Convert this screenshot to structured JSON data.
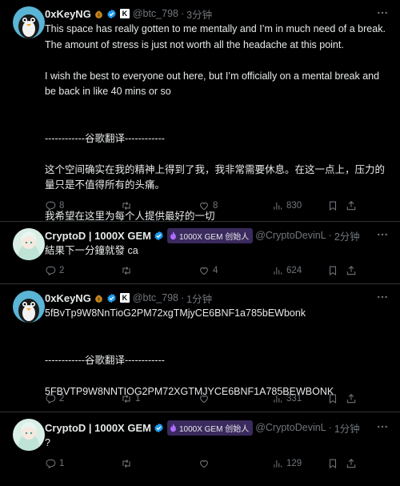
{
  "posts": [
    {
      "name": "0xKeyNG",
      "handle": "@btc_798",
      "time": "3分钟",
      "text": "This space has really gotten to me mentally and I’m in much need of a break. The amount of stress is just not worth all the headache at this point.\n\nI wish the best to everyone out here, but I’m officially on a mental break and be back in like 40 mins or so\n\n\n------------谷歌翻译------------\n\n这个空间确实在我的精神上得到了我，我非常需要休息。在这一点上，压力的量只是不值得所有的头痛。\n\n我希望在这里为每个人提供最好的一切",
      "replies": "8",
      "reposts": "",
      "likes": "8",
      "views": "830"
    },
    {
      "name": "CryptoD | 1000X GEM",
      "badge": "1000X GEM 创始人",
      "handle": "@CryptoDevinL",
      "time": "2分钟",
      "text": "結果下一分鐘就發 ca",
      "replies": "2",
      "reposts": "",
      "likes": "4",
      "views": "624"
    },
    {
      "name": "0xKeyNG",
      "handle": "@btc_798",
      "time": "1分钟",
      "text": "5fBvTp9W8NnTioG2PM72xgTMjyCE6BNF1a785bEWbonk\n\n\n------------谷歌翻译------------\n\n5FBVTP9W8NNTIOG2PM72XGTMJYCE6BNF1A785BEWBONK",
      "replies": "2",
      "reposts": "1",
      "likes": "",
      "views": "331"
    },
    {
      "name": "CryptoD | 1000X GEM",
      "badge": "1000X GEM 创始人",
      "handle": "@CryptoDevinL",
      "time": "1分钟",
      "text": "?",
      "replies": "1",
      "reposts": "",
      "likes": "",
      "views": "129"
    }
  ],
  "colors": {
    "background": "#000000",
    "text": "#e7e9ea",
    "muted": "#71767b",
    "verified": "#1d9bf0",
    "badge_bg": "#3a2a5e",
    "divider": "#2f3336"
  },
  "icons": [
    "verified-icon",
    "moneybag-icon",
    "k-logo-icon",
    "flame-icon",
    "more-icon",
    "reply-icon",
    "repost-icon",
    "like-icon",
    "views-icon",
    "bookmark-icon",
    "share-icon"
  ]
}
